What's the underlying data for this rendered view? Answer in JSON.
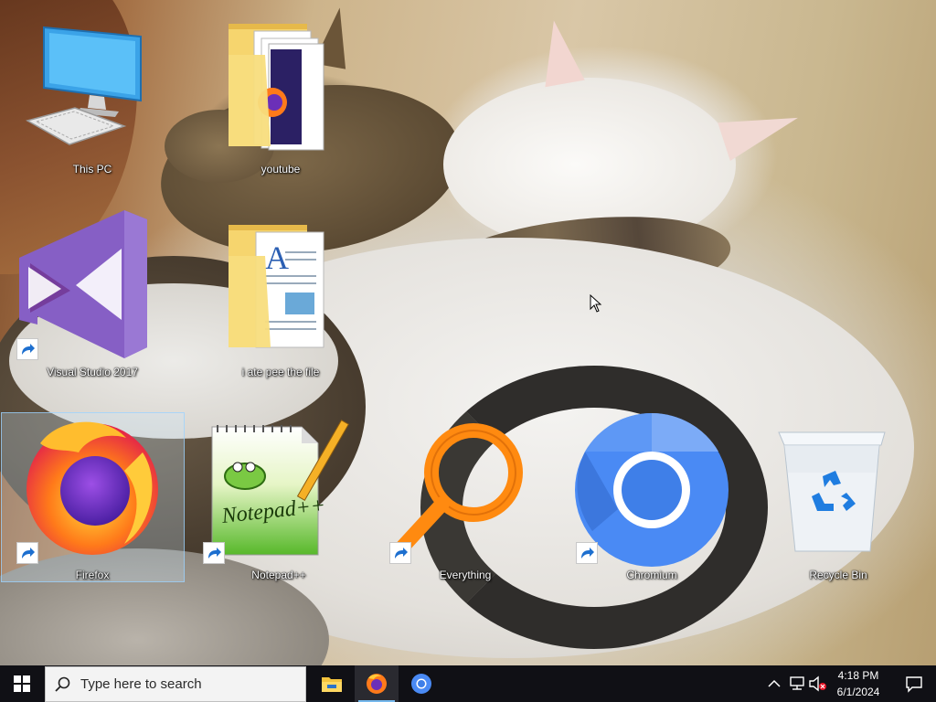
{
  "desktop": {
    "icons": [
      {
        "label": "This PC"
      },
      {
        "label": "youtube"
      },
      {
        "label": "Visual Studio 2017"
      },
      {
        "label": "i ate pee the file"
      },
      {
        "label": "Firefox"
      },
      {
        "label": "Notepad++"
      },
      {
        "label": "Everything"
      },
      {
        "label": "Chromium"
      },
      {
        "label": "Recycle Bin"
      }
    ],
    "notepad_icon_text": "Notepad++"
  },
  "taskbar": {
    "search_placeholder": "Type here to search",
    "pinned": [
      "file-explorer",
      "firefox",
      "chromium"
    ],
    "clock": {
      "time": "4:18 PM",
      "date": "6/1/2024"
    }
  },
  "colors": {
    "taskbar": "#101015",
    "accent": "#76b9ed",
    "firefox_orange": "#ff7a1a",
    "vs_purple": "#865fc5",
    "chromium_blue": "#4a8af4"
  }
}
